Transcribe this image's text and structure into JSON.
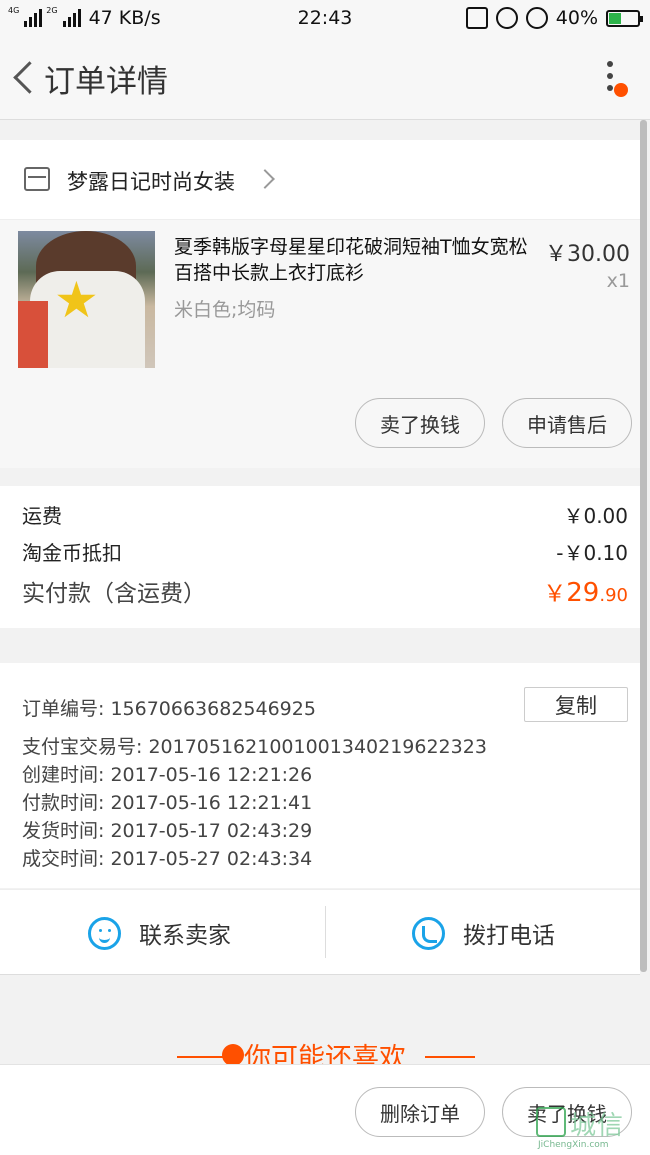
{
  "status_bar": {
    "network_tags": [
      "4G",
      "2G"
    ],
    "speed": "47 KB/s",
    "time": "22:43",
    "battery": "40%"
  },
  "nav": {
    "title": "订单详情"
  },
  "store": {
    "name": "梦露日记时尚女装"
  },
  "product": {
    "title": "夏季韩版字母星星印花破洞短袖T恤女宽松百搭中长款上衣打底衫",
    "sku": "米白色;均码",
    "price": "￥30.00",
    "qty": "x1",
    "btn_sell": "卖了换钱",
    "btn_after_sale": "申请售后"
  },
  "cost": {
    "shipping_label": "运费",
    "shipping_value": "￥0.00",
    "coin_label": "淘金币抵扣",
    "coin_value": "-￥0.10",
    "total_label": "实付款（含运费）",
    "total_currency": "￥",
    "total_int": "29",
    "total_dec": ".90"
  },
  "info": {
    "order_no": "订单编号:  15670663682546925",
    "copy_label": "复制",
    "alipay_no": "支付宝交易号:  2017051621001001340219622323",
    "created": "创建时间:  2017-05-16 12:21:26",
    "paid": "付款时间:  2017-05-16 12:21:41",
    "shipped": "发货时间:  2017-05-17 02:43:29",
    "completed": "成交时间:  2017-05-27 02:43:34"
  },
  "contact": {
    "seller": "联系卖家",
    "call": "拨打电话"
  },
  "recommend": {
    "title": "你可能还喜欢"
  },
  "bottom": {
    "delete": "删除订单",
    "sell": "卖了换钱"
  },
  "watermark": {
    "name": "城信",
    "domain": "JiChengXin.com"
  },
  "colors": {
    "accent": "#ff5000",
    "link_blue": "#1aa3e8"
  }
}
